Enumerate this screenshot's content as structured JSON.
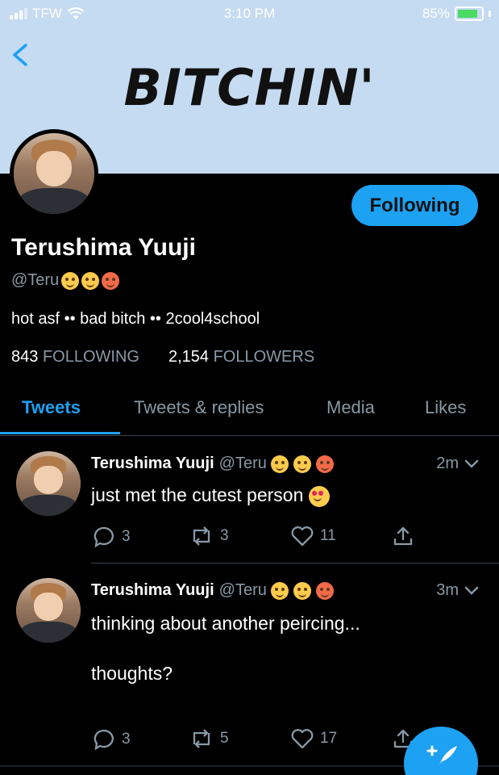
{
  "status_bar": {
    "carrier": "TFW",
    "time": "3:10 PM",
    "battery": "85%"
  },
  "banner": {
    "title": "BITCHIN'",
    "color": "#c5dbf2"
  },
  "profile": {
    "display_name": "Terushima Yuuji",
    "handle": "@Teru",
    "bio": "hot asf •• bad bitch •• 2cool4school",
    "following_count": "843",
    "following_label": "FOLLOWING",
    "followers_count": "2,154",
    "followers_label": "FOLLOWERS",
    "follow_button": "Following"
  },
  "tabs": [
    {
      "label": "Tweets",
      "active": true
    },
    {
      "label": "Tweets & replies",
      "active": false
    },
    {
      "label": "Media",
      "active": false
    },
    {
      "label": "Likes",
      "active": false
    }
  ],
  "tweets": [
    {
      "name": "Terushima Yuuji",
      "handle": "@Teru",
      "time": "2m",
      "text": "just met the cutest person",
      "replies": "3",
      "retweets": "3",
      "likes": "11"
    },
    {
      "name": "Terushima Yuuji",
      "handle": "@Teru",
      "time": "3m",
      "text_line1": "thinking about another peircing...",
      "text_line2": "thoughts?",
      "replies": "3",
      "retweets": "5",
      "likes": "17"
    }
  ],
  "colors": {
    "accent": "#1da1f2",
    "muted": "#8899a6",
    "background": "#000000"
  }
}
